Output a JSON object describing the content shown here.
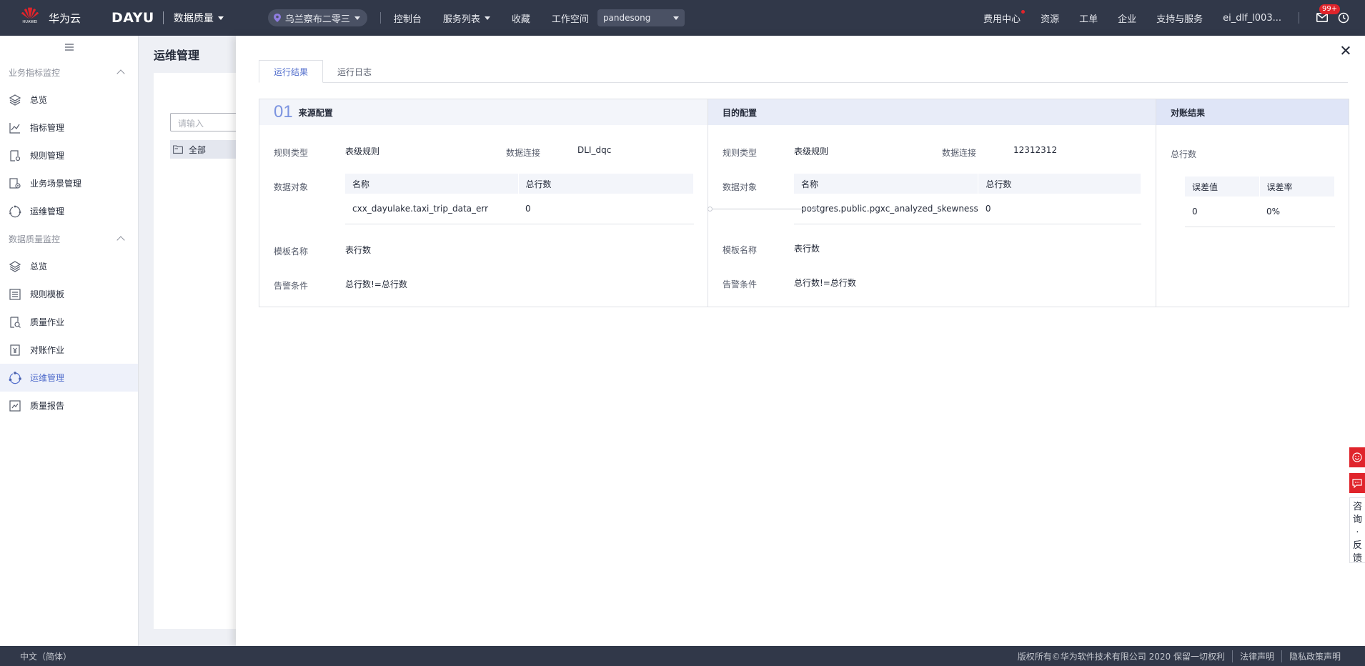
{
  "topnav": {
    "logo_text": "华为云",
    "logo_word": "HUAWEI",
    "product": "DAYU",
    "module": "数据质量",
    "region": "乌兰察布二零三",
    "links": [
      "控制台",
      "服务列表",
      "收藏",
      "工作空间"
    ],
    "workspace": "pandesong",
    "right_links": [
      "费用中心",
      "资源",
      "工单",
      "企业",
      "支持与服务",
      "ei_dlf_l003..."
    ],
    "mail_badge": "99+"
  },
  "sidebar": {
    "groups": [
      {
        "title": "业务指标监控",
        "items": [
          {
            "label": "总览",
            "icon": "layers-icon"
          },
          {
            "label": "指标管理",
            "icon": "line-chart-icon"
          },
          {
            "label": "规则管理",
            "icon": "rule-doc-icon"
          },
          {
            "label": "业务场景管理",
            "icon": "scene-gear-icon"
          },
          {
            "label": "运维管理",
            "icon": "ops-cycle-icon"
          }
        ]
      },
      {
        "title": "数据质量监控",
        "items": [
          {
            "label": "总览",
            "icon": "layers-icon"
          },
          {
            "label": "规则模板",
            "icon": "template-list-icon"
          },
          {
            "label": "质量作业",
            "icon": "quality-search-icon"
          },
          {
            "label": "对账作业",
            "icon": "yen-doc-icon"
          },
          {
            "label": "运维管理",
            "icon": "ops-cycle-icon",
            "active": true
          },
          {
            "label": "质量报告",
            "icon": "report-chart-icon"
          }
        ]
      }
    ]
  },
  "page": {
    "title": "运维管理",
    "search_placeholder": "请输入",
    "tree_all": "全部"
  },
  "drawer": {
    "tabs": [
      "运行结果",
      "运行日志"
    ],
    "source": {
      "step": "01",
      "title": "来源配置",
      "rule_type_label": "规则类型",
      "rule_type": "表级规则",
      "conn_label": "数据连接",
      "conn": "DLI_dqc",
      "object_label": "数据对象",
      "table_headers": [
        "名称",
        "总行数"
      ],
      "table_rows": [
        [
          "cxx_dayulake.taxi_trip_data_err",
          "0"
        ]
      ],
      "template_label": "模板名称",
      "template": "表行数",
      "alarm_label": "告警条件",
      "alarm": "总行数!=总行数"
    },
    "target": {
      "title": "目的配置",
      "rule_type_label": "规则类型",
      "rule_type": "表级规则",
      "conn_label": "数据连接",
      "conn": "12312312",
      "object_label": "数据对象",
      "table_headers": [
        "名称",
        "总行数"
      ],
      "table_rows": [
        [
          "postgres.public.pgxc_analyzed_skewness",
          "0"
        ]
      ],
      "template_label": "模板名称",
      "template": "表行数",
      "alarm_label": "告警条件",
      "alarm": "总行数!=总行数"
    },
    "compare": {
      "title": "对账结果",
      "metric": "总行数",
      "table_headers": [
        "误差值",
        "误差率"
      ],
      "table_rows": [
        [
          "0",
          "0%"
        ]
      ]
    }
  },
  "footer": {
    "lang": "中文（简体）",
    "links": [
      "版权所有©华为软件技术有限公司 2020 保留一切权利",
      "法律声明",
      "隐私政策声明"
    ]
  },
  "feedback": {
    "chars": [
      "咨",
      "询",
      "·",
      "反",
      "馈"
    ]
  }
}
